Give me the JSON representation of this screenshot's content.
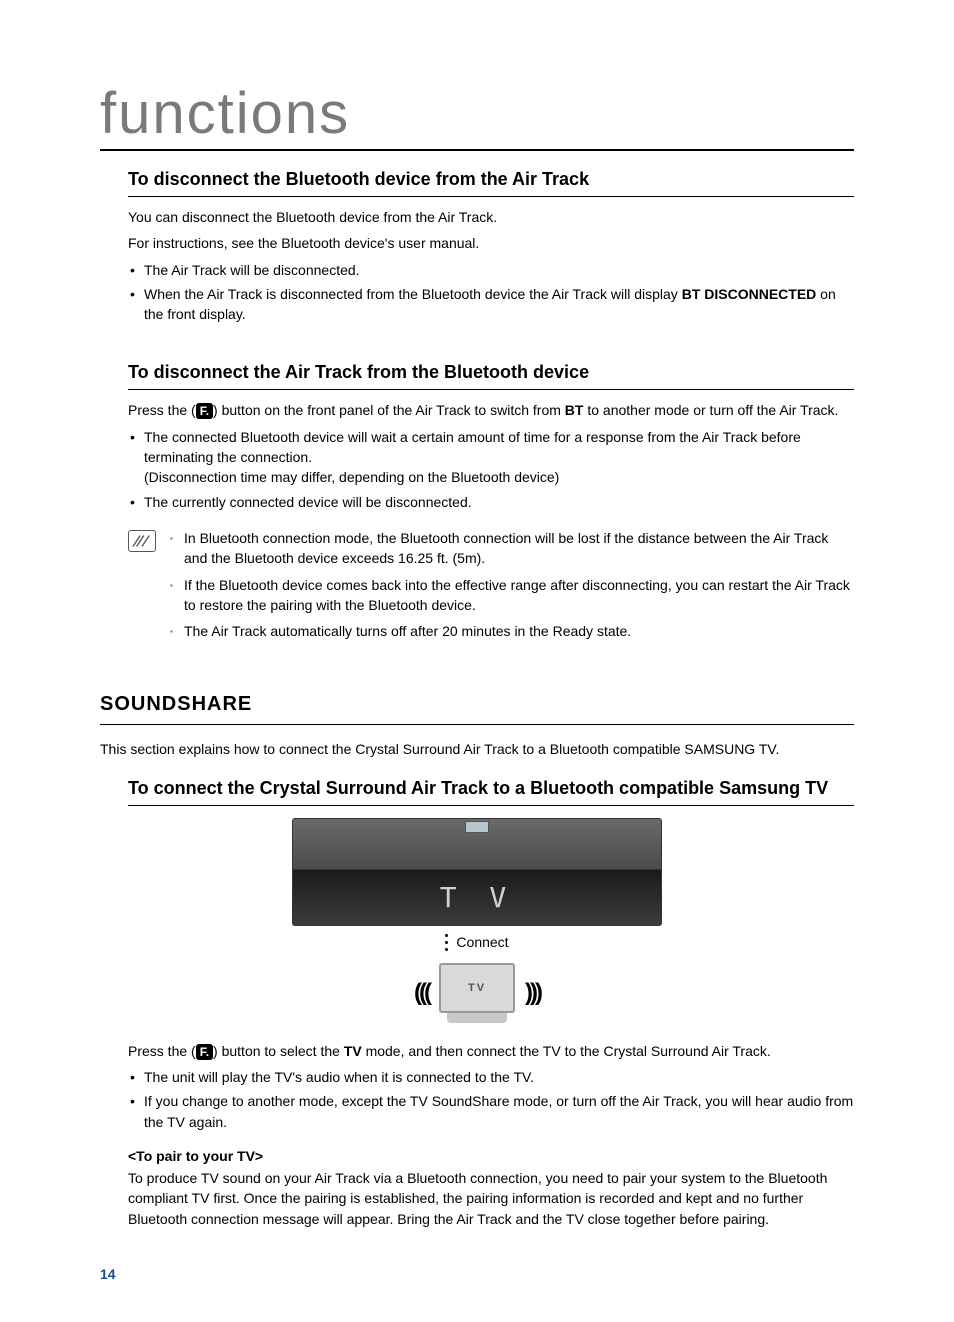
{
  "pageTitle": "functions",
  "sec1": {
    "heading": "To disconnect the Bluetooth device from the Air Track",
    "p1": "You can disconnect the Bluetooth device from the Air Track.",
    "p2": "For instructions, see the Bluetooth device's user manual.",
    "b1": "The Air Track will be disconnected.",
    "b2a": "When the Air Track is disconnected from the Bluetooth device the Air Track will display ",
    "b2b": "BT DISCONNECTED",
    "b2c": " on the front display."
  },
  "sec2": {
    "heading": "To disconnect the Air Track from the Bluetooth device",
    "p1a": "Press the (",
    "p1f": "F.",
    "p1b": ") button on the front panel of the Air Track to switch from ",
    "p1bt": "BT",
    "p1c": " to another mode or turn off the Air Track.",
    "b1": "The connected Bluetooth device will wait a certain amount of time for a response from the Air Track before terminating the connection.",
    "b1sub": "(Disconnection time may differ, depending on the Bluetooth device)",
    "b2": "The currently connected device will be disconnected."
  },
  "notes": {
    "n1": "In Bluetooth connection mode, the Bluetooth connection will be lost if the distance between the Air Track and the Bluetooth device exceeds 16.25 ft. (5m).",
    "n2": "If the Bluetooth device comes back into the effective range after disconnecting, you can restart the Air Track to restore the pairing with the Bluetooth device.",
    "n3": "The Air Track automatically turns off after 20 minutes in the Ready state."
  },
  "soundshare": {
    "heading": "SOUNDSHARE",
    "intro": "This section explains how to connect the Crystal Surround Air Track to a Bluetooth compatible SAMSUNG TV.",
    "subheading": "To connect the Crystal Surround Air Track to a Bluetooth compatible Samsung TV",
    "displayText": "T V",
    "connectLabel": "Connect",
    "tvLabel": "TV",
    "p1a": "Press the (",
    "p1f": "F.",
    "p1b": ") button to select the ",
    "p1tv": "TV",
    "p1c": " mode, and then connect the TV to the Crystal Surround Air Track.",
    "b1": "The unit will play the TV's audio when it is connected to the TV.",
    "b2": "If you change to another mode, except the TV SoundShare mode, or turn off the Air Track, you will hear audio from the TV again.",
    "pairHeading": "<To pair to your TV>",
    "pairText": "To produce TV sound on your Air Track via a Bluetooth connection, you need to pair your system to the Bluetooth compliant TV first. Once the pairing is established, the pairing information is recorded and kept and no further Bluetooth connection message will appear. Bring the Air Track and the TV close together before pairing."
  },
  "pageNumber": "14"
}
